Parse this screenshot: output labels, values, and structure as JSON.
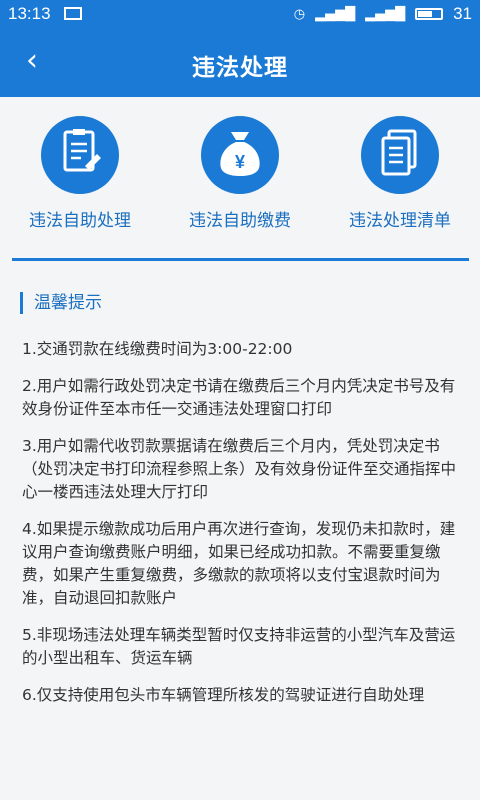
{
  "status_bar": {
    "time": "13:13",
    "battery": "31"
  },
  "nav": {
    "title": "违法处理",
    "back_icon": "chevron-left-icon"
  },
  "actions": [
    {
      "label": "违法自助处理",
      "icon": "document-icon"
    },
    {
      "label": "违法自助缴费",
      "icon": "money-bag-icon"
    },
    {
      "label": "违法处理清单",
      "icon": "list-icon"
    }
  ],
  "tips": {
    "heading": "温馨提示",
    "items": [
      "1.交通罚款在线缴费时间为3:00-22:00",
      "2.用户如需行政处罚决定书请在缴费后三个月内凭决定书号及有效身份证件至本市任一交通违法处理窗口打印",
      "3.用户如需代收罚款票据请在缴费后三个月内，凭处罚决定书（处罚决定书打印流程参照上条）及有效身份证件至交通指挥中心一楼西违法处理大厅打印",
      "4.如果提示缴款成功后用户再次进行查询，发现仍未扣款时，建议用户查询缴费账户明细，如果已经成功扣款。不需要重复缴费，如果产生重复缴费，多缴款的款项将以支付宝退款时间为准，自动退回扣款账户",
      "5.非现场违法处理车辆类型暂时仅支持非运营的小型汽车及营运的小型出租车、货运车辆",
      "6.仅支持使用包头市车辆管理所核发的驾驶证进行自助处理"
    ]
  },
  "colors": {
    "primary": "#1a7ad6",
    "label": "#1a6fc0",
    "background": "#f4f5f7"
  }
}
